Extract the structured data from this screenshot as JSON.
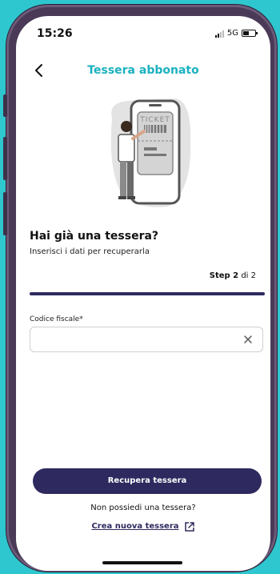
{
  "status_bar": {
    "time": "15:26",
    "network": "5G"
  },
  "header": {
    "back_icon": "chevron-left-icon",
    "title": "Tessera abbonato"
  },
  "illustration": {
    "ticket_text": "TICKET"
  },
  "content": {
    "question": "Hai già una tessera?",
    "subtitle": "Inserisci i dati per recuperarla",
    "step_label": "Step 2",
    "step_suffix": "di 2",
    "progress": 1.0,
    "field_label": "Codice fiscale*",
    "field_value": "",
    "field_placeholder": "",
    "clear_icon": "close-icon"
  },
  "footer": {
    "primary_button": "Recupera tessera",
    "no_card_text": "Non possiedi una tessera?",
    "create_link": "Crea nuova tessera",
    "link_icon": "external-link-icon"
  },
  "colors": {
    "accent": "#1ab1c0",
    "primary": "#2e2a5f",
    "background": "#2ec7cf",
    "device": "#4b3a57"
  }
}
